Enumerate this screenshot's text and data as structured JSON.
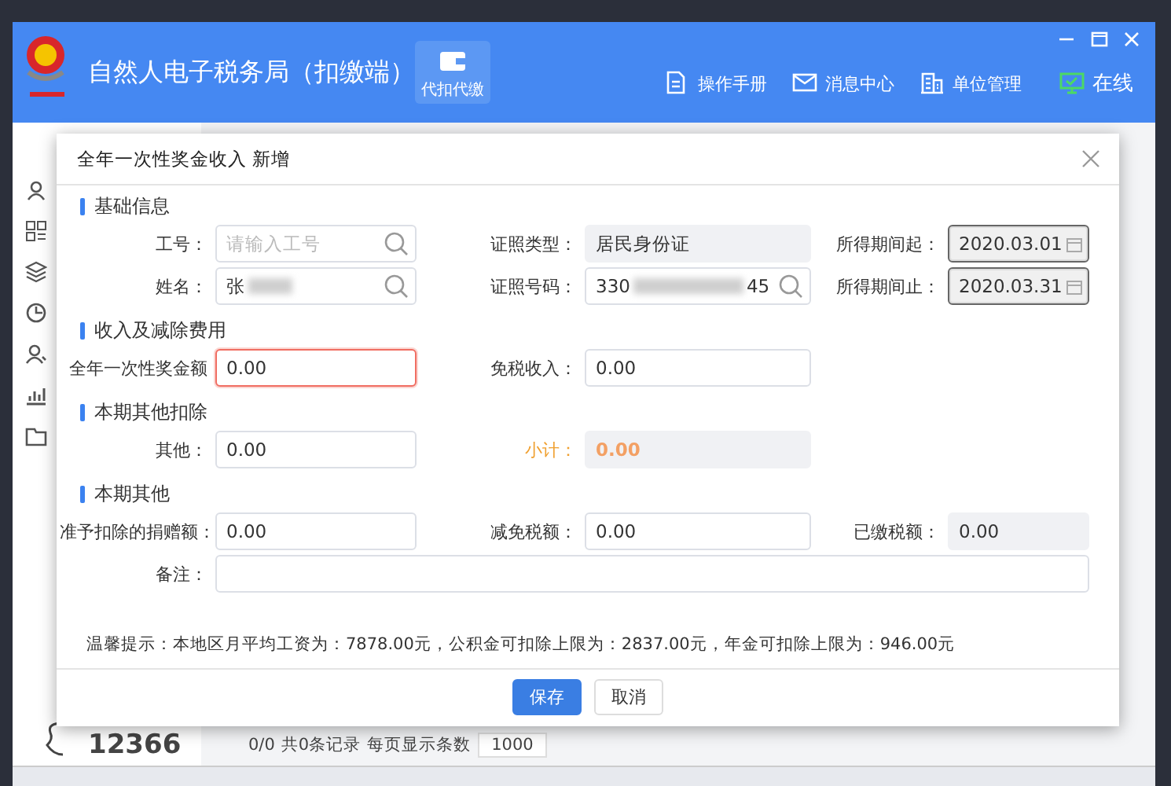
{
  "app": {
    "title": "自然人电子税务局（扣缴端）",
    "module_tab": {
      "label": "代扣代缴",
      "selected": true
    },
    "toolbar": [
      {
        "label": "操作手册",
        "kind": "document"
      },
      {
        "label": "消息中心",
        "kind": "mail"
      },
      {
        "label": "单位管理",
        "kind": "building"
      },
      {
        "label": "在线",
        "kind": "monitor"
      }
    ]
  },
  "hotline": "12366",
  "pager": {
    "page": "0/0",
    "total": "共0条记录",
    "page_size_label": "每页显示条数",
    "page_size": "1000"
  },
  "dialog": {
    "title": "全年一次性奖金收入 新增",
    "sections": [
      {
        "title": "基础信息",
        "rows": [
          [
            {
              "label": "工号：",
              "kind": "search",
              "placeholder": "请输入工号",
              "invalid": false
            },
            {
              "label": "证照类型：",
              "kind": "readonly",
              "value": "居民身份证",
              "invalid": false
            },
            {
              "label": "所得期间起：",
              "kind": "date",
              "value": "2020.03.01",
              "invalid": false
            }
          ],
          [
            {
              "label": "姓名：",
              "kind": "masked",
              "value_parts": [
                "张"
              ],
              "invalid": false
            },
            {
              "label": "证照号码：",
              "kind": "masked",
              "value_parts": [
                "330",
                "45"
              ],
              "invalid": false
            },
            {
              "label": "所得期间止：",
              "kind": "date",
              "value": "2020.03.31",
              "invalid": false
            }
          ]
        ]
      },
      {
        "title": "收入及减除费用",
        "rows": [
          [
            {
              "label": "全年一次性奖金额",
              "kind": "text",
              "value": "0.00",
              "invalid": true
            },
            {
              "label": "免税收入：",
              "kind": "text",
              "value": "0.00",
              "invalid": false
            }
          ]
        ]
      },
      {
        "title": "本期其他扣除",
        "rows": [
          [
            {
              "label": "其他：",
              "kind": "text",
              "value": "0.00",
              "invalid": false
            },
            {
              "label": "小计：",
              "kind": "subtotal",
              "value": "0.00",
              "invalid": false
            }
          ]
        ]
      },
      {
        "title": "本期其他",
        "rows": [
          [
            {
              "label": "准予扣除的捐赠额：",
              "kind": "text",
              "value": "0.00",
              "invalid": false
            },
            {
              "label": "减免税额：",
              "kind": "text",
              "value": "0.00",
              "invalid": false
            },
            {
              "label": "已缴税额：",
              "kind": "readonly",
              "value": "0.00",
              "invalid": false
            }
          ],
          [
            {
              "label": "备注：",
              "kind": "wide",
              "invalid": false
            }
          ]
        ]
      }
    ],
    "hint": "温馨提示：本地区月平均工资为：7878.00元，公积金可扣除上限为：2837.00元，年金可扣除上限为：946.00元",
    "buttons": [
      {
        "label": "保存",
        "kind": "primary"
      },
      {
        "label": "取消",
        "kind": "default"
      }
    ]
  }
}
